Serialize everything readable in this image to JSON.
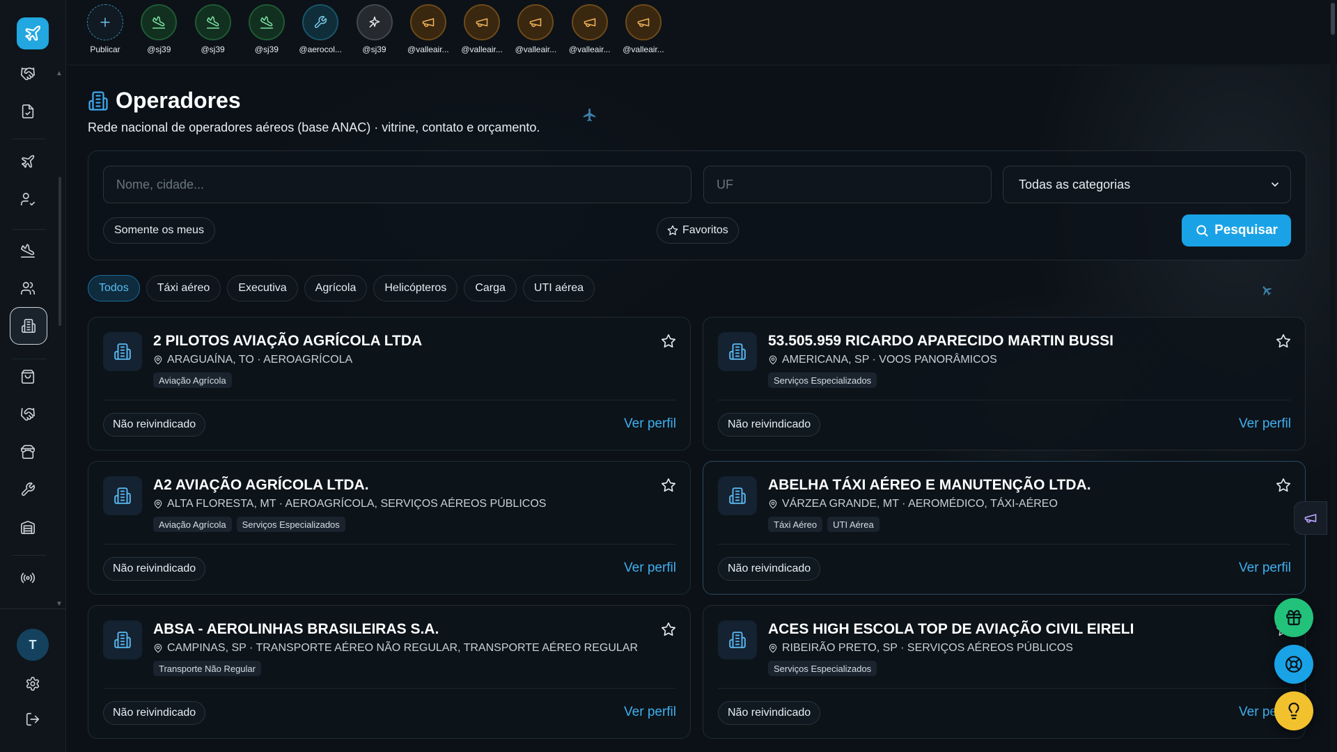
{
  "stories": [
    {
      "label": "Publicar",
      "kind": "add",
      "icon": "plus-icon"
    },
    {
      "label": "@sj39",
      "kind": "green",
      "icon": "landing-plane-icon"
    },
    {
      "label": "@sj39",
      "kind": "green",
      "icon": "landing-plane-icon"
    },
    {
      "label": "@sj39",
      "kind": "green",
      "icon": "landing-plane-icon"
    },
    {
      "label": "@aerocol...",
      "kind": "teal",
      "icon": "wrench-icon"
    },
    {
      "label": "@sj39",
      "kind": "gray",
      "icon": "sparkle-icon"
    },
    {
      "label": "@valleair...",
      "kind": "amber",
      "icon": "megaphone-icon"
    },
    {
      "label": "@valleair...",
      "kind": "amber",
      "icon": "megaphone-icon"
    },
    {
      "label": "@valleair...",
      "kind": "amber",
      "icon": "megaphone-icon"
    },
    {
      "label": "@valleair...",
      "kind": "amber",
      "icon": "megaphone-icon"
    },
    {
      "label": "@valleair...",
      "kind": "amber",
      "icon": "megaphone-icon"
    }
  ],
  "sidebar": {
    "user_initial": "T"
  },
  "header": {
    "title": "Operadores",
    "subtitle": "Rede nacional de operadores aéreos (base ANAC) · vitrine, contato e orçamento."
  },
  "search": {
    "name_placeholder": "Nome, cidade...",
    "uf_placeholder": "UF",
    "category_selected": "Todas as categorias",
    "only_mine_label": "Somente os meus",
    "favorites_label": "Favoritos",
    "search_button": "Pesquisar"
  },
  "tabs": [
    "Todos",
    "Táxi aéreo",
    "Executiva",
    "Agrícola",
    "Helicópteros",
    "Carga",
    "UTI aérea"
  ],
  "cards": [
    {
      "name": "2 PILOTOS AVIAÇÃO AGRÍCOLA LTDA",
      "location": "ARAGUAÍNA, TO · AEROAGRÍCOLA",
      "tags": [
        "Aviação Agrícola"
      ],
      "status": "Não reivindicado",
      "link": "Ver perfil"
    },
    {
      "name": "53.505.959 RICARDO APARECIDO MARTIN BUSSI",
      "location": "AMERICANA, SP · VOOS PANORÂMICOS",
      "tags": [
        "Serviços Especializados"
      ],
      "status": "Não reivindicado",
      "link": "Ver perfil"
    },
    {
      "name": "A2 AVIAÇÃO AGRÍCOLA LTDA.",
      "location": "ALTA FLORESTA, MT · AEROAGRÍCOLA, SERVIÇOS AÉREOS PÚBLICOS",
      "tags": [
        "Aviação Agrícola",
        "Serviços Especializados"
      ],
      "status": "Não reivindicado",
      "link": "Ver perfil"
    },
    {
      "name": "ABELHA TÁXI AÉREO E MANUTENÇÃO LTDA.",
      "location": "VÁRZEA GRANDE, MT · AEROMÉDICO, TÁXI-AÉREO",
      "tags": [
        "Táxi Aéreo",
        "UTI Aérea"
      ],
      "status": "Não reivindicado",
      "link": "Ver perfil"
    },
    {
      "name": "ABSA - AEROLINHAS BRASILEIRAS S.A.",
      "location": "CAMPINAS, SP · TRANSPORTE AÉREO NÃO REGULAR, TRANSPORTE AÉREO REGULAR",
      "tags": [
        "Transporte Não Regular"
      ],
      "status": "Não reivindicado",
      "link": "Ver perfil"
    },
    {
      "name": "ACES HIGH ESCOLA TOP DE AVIAÇÃO CIVIL EIRELI",
      "location": "RIBEIRÃO PRETO, SP · SERVIÇOS AÉREOS PÚBLICOS",
      "tags": [
        "Serviços Especializados"
      ],
      "status": "Não reivindicado",
      "link": "Ver perfil"
    }
  ],
  "colors": {
    "accent": "#1aa2e6",
    "background": "#0b1117",
    "fab_gift": "#22c27a",
    "fab_help": "#1aa2e6",
    "fab_idea": "#f2c12e"
  }
}
